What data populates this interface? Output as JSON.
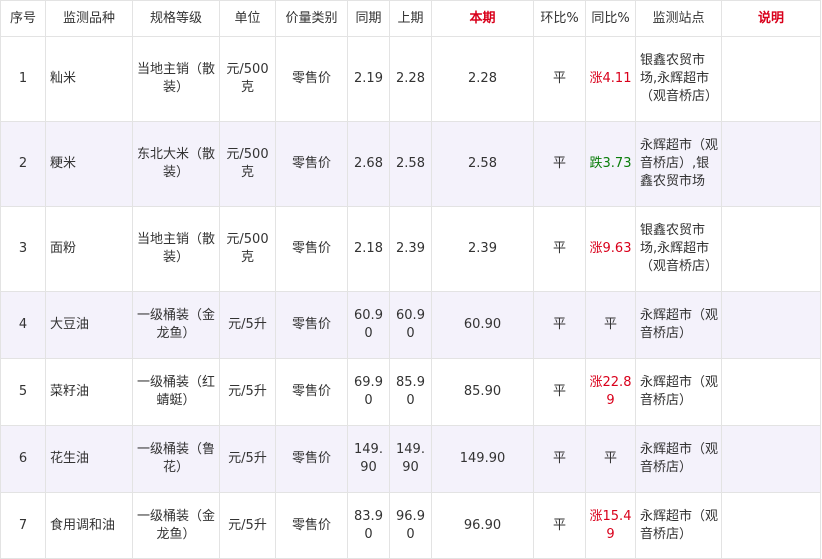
{
  "headers": [
    "序号",
    "监测品种",
    "规格等级",
    "单位",
    "价量类别",
    "同期",
    "上期",
    "本期",
    "环比%",
    "同比%",
    "监测站点",
    "说明"
  ],
  "colors": {
    "accent_red": "#d9001b",
    "down_green": "#0a7d0a",
    "stripe": "#f4f2fb",
    "border": "#e3e3e3"
  },
  "rows": [
    {
      "no": "1",
      "name": "籼米",
      "spec": "当地主销（散装）",
      "unit": "元/500克",
      "kind": "零售价",
      "same": "2.19",
      "prev": "2.28",
      "cur": "2.28",
      "mom": "平",
      "yoy": "涨4.11",
      "yoy_dir": "up",
      "site": "银鑫农贸市场,永辉超市（观音桥店）",
      "note": ""
    },
    {
      "no": "2",
      "name": "粳米",
      "spec": "东北大米（散装）",
      "unit": "元/500克",
      "kind": "零售价",
      "same": "2.68",
      "prev": "2.58",
      "cur": "2.58",
      "mom": "平",
      "yoy": "跌3.73",
      "yoy_dir": "down",
      "site": "永辉超市（观音桥店）,银鑫农贸市场",
      "note": ""
    },
    {
      "no": "3",
      "name": "面粉",
      "spec": "当地主销（散装）",
      "unit": "元/500克",
      "kind": "零售价",
      "same": "2.18",
      "prev": "2.39",
      "cur": "2.39",
      "mom": "平",
      "yoy": "涨9.63",
      "yoy_dir": "up",
      "site": "银鑫农贸市场,永辉超市（观音桥店）",
      "note": ""
    },
    {
      "no": "4",
      "name": "大豆油",
      "spec": "一级桶装（金龙鱼）",
      "unit": "元/5升",
      "kind": "零售价",
      "same": "60.90",
      "prev": "60.90",
      "cur": "60.90",
      "mom": "平",
      "yoy": "平",
      "yoy_dir": "flat",
      "site": "永辉超市（观音桥店）",
      "note": ""
    },
    {
      "no": "5",
      "name": "菜籽油",
      "spec": "一级桶装（红蜻蜓）",
      "unit": "元/5升",
      "kind": "零售价",
      "same": "69.90",
      "prev": "85.90",
      "cur": "85.90",
      "mom": "平",
      "yoy": "涨22.89",
      "yoy_dir": "up",
      "site": "永辉超市（观音桥店）",
      "note": ""
    },
    {
      "no": "6",
      "name": "花生油",
      "spec": "一级桶装（鲁花）",
      "unit": "元/5升",
      "kind": "零售价",
      "same": "149.90",
      "prev": "149.90",
      "cur": "149.90",
      "mom": "平",
      "yoy": "平",
      "yoy_dir": "flat",
      "site": "永辉超市（观音桥店）",
      "note": ""
    },
    {
      "no": "7",
      "name": "食用调和油",
      "spec": "一级桶装（金龙鱼）",
      "unit": "元/5升",
      "kind": "零售价",
      "same": "83.90",
      "prev": "96.90",
      "cur": "96.90",
      "mom": "平",
      "yoy": "涨15.49",
      "yoy_dir": "up",
      "site": "永辉超市（观音桥店）",
      "note": ""
    }
  ]
}
